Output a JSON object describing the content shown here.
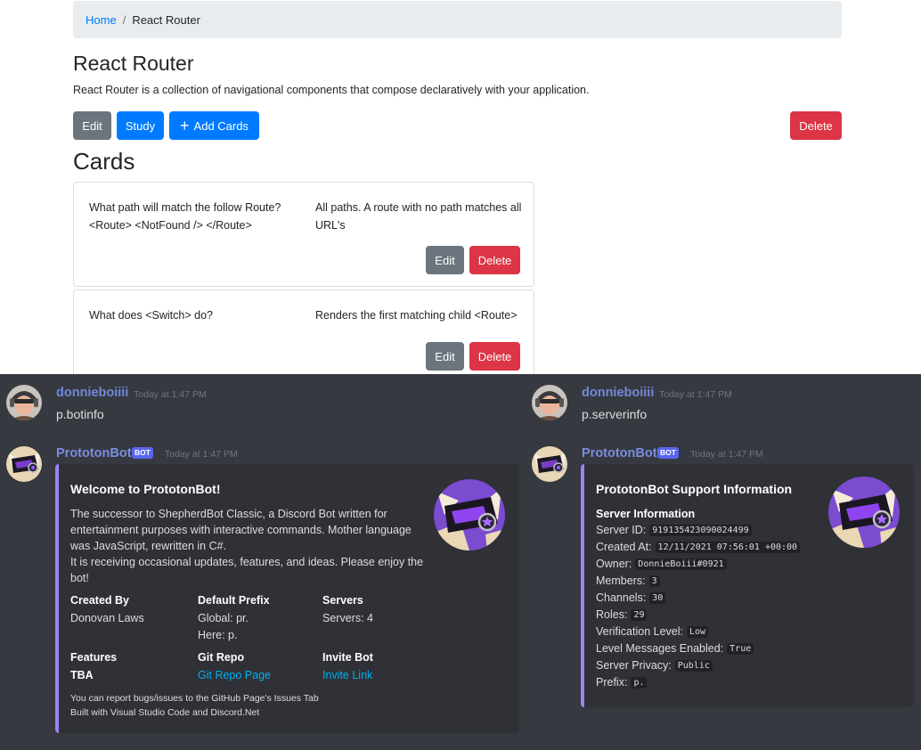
{
  "breadcrumb": {
    "home": "Home",
    "separator": "/",
    "current": "React Router"
  },
  "deck": {
    "title": "React Router",
    "description": "React Router is a collection of navigational components that compose declaratively with your application."
  },
  "toolbar": {
    "edit": "Edit",
    "study": "Study",
    "add_cards": "Add Cards",
    "delete": "Delete"
  },
  "cards_heading": "Cards",
  "cards": [
    {
      "front": "What path will match the follow Route? <Route> <NotFound /> </Route>",
      "back": "All paths. A route with no path matches all URL's",
      "edit": "Edit",
      "delete": "Delete"
    },
    {
      "front": "What does <Switch> do?",
      "back": "Renders the first matching child <Route>",
      "edit": "Edit",
      "delete": "Delete"
    }
  ],
  "discord": {
    "colors": {
      "background": "#36393f",
      "embed": "#2f3136",
      "accent": "#9b84ee",
      "username": "#7289da",
      "link": "#00aff4",
      "badge": "#5865f2"
    },
    "left": {
      "user": {
        "name": "donnieboiiii",
        "time": "Today at 1:47 PM",
        "text": "p.botinfo"
      },
      "bot": {
        "name": "PrototonBot",
        "badge": "BOT",
        "time": "Today at 1:47 PM"
      },
      "embed": {
        "title": "Welcome to PrototonBot!",
        "description": "The successor to ShepherdBot Classic, a Discord Bot written for entertainment purposes with interactive commands. Mother language was JavaScript, rewritten in C#.",
        "description2": "It is receiving occasional updates, features, and ideas. Please enjoy the bot!",
        "fields": {
          "created_by": {
            "name": "Created By",
            "value": "Donovan Laws"
          },
          "prefix": {
            "name": "Default Prefix",
            "value1": "Global: pr.",
            "value2": "Here: p."
          },
          "servers": {
            "name": "Servers",
            "value": "Servers: 4"
          },
          "features": {
            "name": "Features",
            "value": "TBA"
          },
          "repo": {
            "name": "Git Repo",
            "value": "Git Repo Page"
          },
          "invite": {
            "name": "Invite Bot",
            "value": "Invite Link"
          }
        },
        "footer1": "You can report bugs/issues to the GitHub Page's Issues Tab",
        "footer2": "Built with Visual Studio Code and Discord.Net"
      }
    },
    "right": {
      "user": {
        "name": "donnieboiiii",
        "time": "Today at 1:47 PM",
        "text": "p.serverinfo"
      },
      "bot": {
        "name": "PrototonBot",
        "badge": "BOT",
        "time": "Today at 1:47 PM"
      },
      "embed": {
        "title": "PrototonBot Support Information",
        "subtitle": "Server Information",
        "rows": [
          {
            "label": "Server ID:",
            "value": "919135423090024499"
          },
          {
            "label": "Created At:",
            "value": "12/11/2021 07:56:01 +00:00"
          },
          {
            "label": "Owner:",
            "value": "DonnieBoiii#0921"
          },
          {
            "label": "Members:",
            "value": "3"
          },
          {
            "label": "Channels:",
            "value": "30"
          },
          {
            "label": "Roles:",
            "value": "29"
          },
          {
            "label": "Verification Level:",
            "value": "Low"
          },
          {
            "label": "Level Messages Enabled:",
            "value": "True"
          },
          {
            "label": "Server Privacy:",
            "value": "Public"
          },
          {
            "label": "Prefix:",
            "value": "p."
          }
        ]
      }
    }
  }
}
